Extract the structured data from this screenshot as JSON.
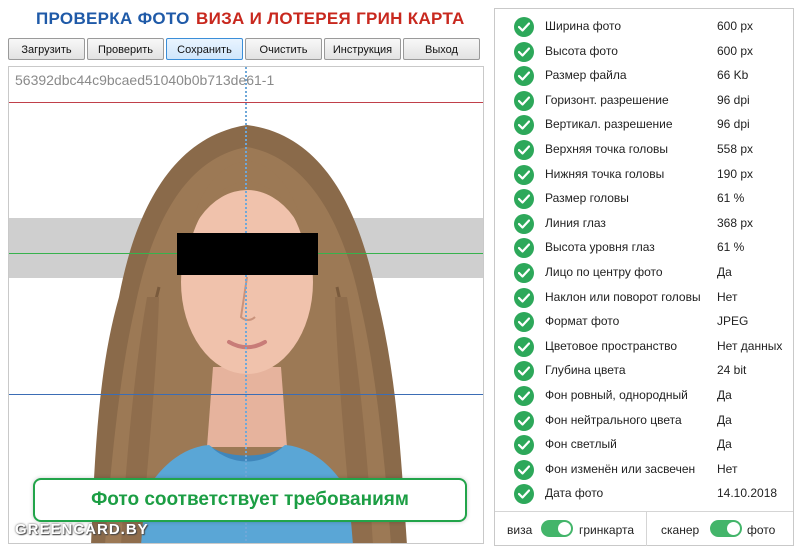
{
  "header": {
    "title_left": "ПРОВЕРКА ФОТО",
    "title_right": "ВИЗА И ЛОТЕРЕЯ ГРИН КАРТА"
  },
  "toolbar": {
    "load": "Загрузить",
    "check": "Проверить",
    "save": "Сохранить",
    "clear": "Очистить",
    "instructions": "Инструкция",
    "exit": "Выход"
  },
  "photo": {
    "file_id": "56392dbc44c9bcaed51040b0b713de61-1",
    "status_message": "Фото соответствует требованиям",
    "watermark": "GREENCARD.BY"
  },
  "checks": [
    {
      "label": "Ширина фото",
      "value": "600 px"
    },
    {
      "label": "Высота фото",
      "value": "600 px"
    },
    {
      "label": "Размер файла",
      "value": "66 Kb"
    },
    {
      "label": "Горизонт. разрешение",
      "value": "96 dpi"
    },
    {
      "label": "Вертикал. разрешение",
      "value": "96 dpi"
    },
    {
      "label": "Верхняя точка головы",
      "value": "558 px"
    },
    {
      "label": "Нижняя точка головы",
      "value": "190 px"
    },
    {
      "label": "Размер головы",
      "value": "61 %"
    },
    {
      "label": "Линия глаз",
      "value": "368 px"
    },
    {
      "label": "Высота уровня глаз",
      "value": "61 %"
    },
    {
      "label": "Лицо по центру фото",
      "value": "Да"
    },
    {
      "label": "Наклон или поворот головы",
      "value": "Нет"
    },
    {
      "label": "Формат фото",
      "value": "JPEG"
    },
    {
      "label": "Цветовое пространство",
      "value": "Нет данных"
    },
    {
      "label": "Глубина цвета",
      "value": "24 bit"
    },
    {
      "label": "Фон ровный, однородный",
      "value": "Да"
    },
    {
      "label": "Фон нейтрального цвета",
      "value": "Да"
    },
    {
      "label": "Фон светлый",
      "value": "Да"
    },
    {
      "label": "Фон изменён или засвечен",
      "value": "Нет"
    },
    {
      "label": "Дата фото",
      "value": "14.10.2018"
    }
  ],
  "toggles": {
    "mode_left": "виза",
    "mode_right": "гринкарта",
    "source_left": "сканер",
    "source_right": "фото"
  },
  "colors": {
    "title_blue": "#1f5aa8",
    "title_red": "#c8281e",
    "ok_green": "#2da85a",
    "top_line": "#c0404a",
    "eye_line": "#37b24d",
    "chin_line": "#3b6db5"
  }
}
